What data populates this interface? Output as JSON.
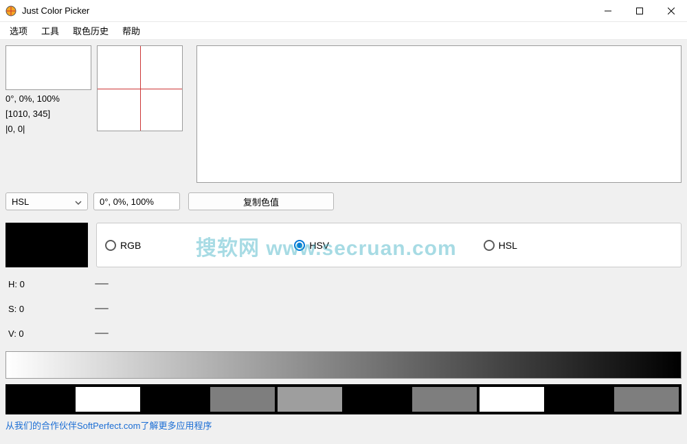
{
  "window": {
    "title": "Just Color Picker"
  },
  "menu": {
    "options": "选项",
    "tools": "工具",
    "history": "取色历史",
    "help": "帮助"
  },
  "coords": {
    "hsl_text": "0°, 0%, 100%",
    "screen_pos": "[1010, 345]",
    "rel_pos": "|0, 0|"
  },
  "format_select": {
    "value": "HSL"
  },
  "color_value_field": {
    "value": "0°, 0%, 100%"
  },
  "copy_button": {
    "label": "复制色值"
  },
  "color_mode": {
    "rgb": "RGB",
    "hsv": "HSV",
    "hsl": "HSL",
    "selected": "hsv"
  },
  "sliders": {
    "h": "H: 0",
    "s": "S: 0",
    "v": "V: 0"
  },
  "palette": [
    "#000000",
    "#ffffff",
    "#000000",
    "#7e7e7e",
    "#9e9e9e",
    "#000000",
    "#7e7e7e",
    "#ffffff",
    "#000000",
    "#7e7e7e"
  ],
  "footer_link": "从我们的合作伙伴SoftPerfect.com了解更多应用程序",
  "watermark": "搜软网 www.secruan.com"
}
